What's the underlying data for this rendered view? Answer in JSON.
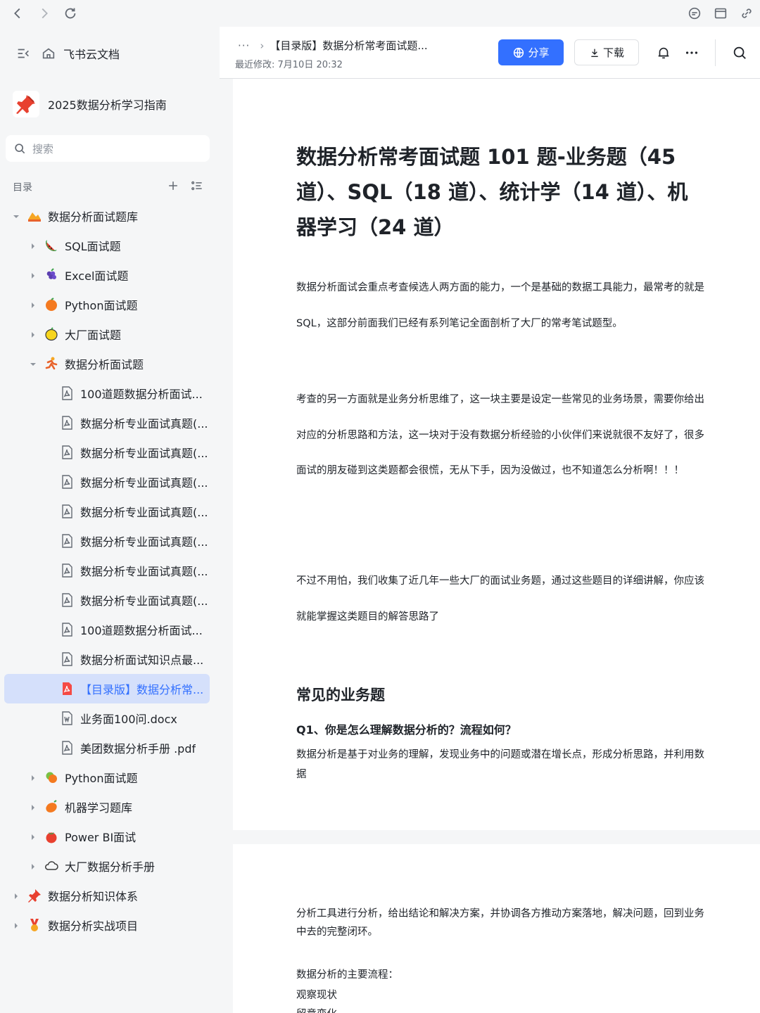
{
  "browser": {
    "back": "back-icon",
    "forward": "forward-icon",
    "reload": "reload-icon",
    "right_icons": [
      "chat-icon",
      "window-icon",
      "link-icon"
    ]
  },
  "sidebar": {
    "home_label": "飞书云文档",
    "book_title": "2025数据分析学习指南",
    "search_placeholder": "搜索",
    "toc_label": "目录",
    "tree": [
      {
        "label": "数据分析面试题库",
        "level": 0,
        "arrow": "down",
        "icon": "hand-icon"
      },
      {
        "label": "SQL面试题",
        "level": 1,
        "arrow": "right",
        "icon": "watermelon-icon"
      },
      {
        "label": "Excel面试题",
        "level": 1,
        "arrow": "right",
        "icon": "grape-icon"
      },
      {
        "label": "Python面试题",
        "level": 1,
        "arrow": "right",
        "icon": "orange-icon"
      },
      {
        "label": "大厂面试题",
        "level": 1,
        "arrow": "right",
        "icon": "lemon-icon"
      },
      {
        "label": "数据分析面试题",
        "level": 1,
        "arrow": "down",
        "icon": "running-icon"
      },
      {
        "label": "100道题数据分析面试...",
        "level": 2,
        "icon": "pdf-icon"
      },
      {
        "label": "数据分析专业面试真题(...",
        "level": 2,
        "icon": "pdf-icon"
      },
      {
        "label": "数据分析专业面试真题(...",
        "level": 2,
        "icon": "pdf-icon"
      },
      {
        "label": "数据分析专业面试真题(...",
        "level": 2,
        "icon": "pdf-icon"
      },
      {
        "label": "数据分析专业面试真题(...",
        "level": 2,
        "icon": "pdf-icon"
      },
      {
        "label": "数据分析专业面试真题(...",
        "level": 2,
        "icon": "pdf-icon"
      },
      {
        "label": "数据分析专业面试真题(...",
        "level": 2,
        "icon": "pdf-icon"
      },
      {
        "label": "数据分析专业面试真题(...",
        "level": 2,
        "icon": "pdf-icon"
      },
      {
        "label": "100道题数据分析面试...",
        "level": 2,
        "icon": "pdf-icon"
      },
      {
        "label": "数据分析面试知识点最...",
        "level": 2,
        "icon": "pdf-icon"
      },
      {
        "label": "【目录版】数据分析常...",
        "level": 2,
        "icon": "pdf-red-icon",
        "active": true
      },
      {
        "label": "业务面100问.docx",
        "level": 2,
        "icon": "word-icon"
      },
      {
        "label": "美团数据分析手册 .pdf",
        "level": 2,
        "icon": "pdf-icon"
      },
      {
        "label": "Python面试题",
        "level": 1,
        "arrow": "right",
        "icon": "fruit-icon"
      },
      {
        "label": "机器学习题库",
        "level": 1,
        "arrow": "right",
        "icon": "mango-icon"
      },
      {
        "label": "Power BI面试",
        "level": 1,
        "arrow": "right",
        "icon": "tomato-icon"
      },
      {
        "label": "大厂数据分析手册",
        "level": 1,
        "arrow": "right",
        "icon": "cloud-icon"
      },
      {
        "label": "数据分析知识体系",
        "level": 0,
        "arrow": "right",
        "icon": "pushpin-icon"
      },
      {
        "label": "数据分析实战项目",
        "level": 0,
        "arrow": "right",
        "icon": "medal-icon"
      }
    ]
  },
  "header": {
    "more": "···",
    "breadcrumb": "【目录版】数据分析常考面试题...",
    "modified": "最近修改: 7月10日 20:32",
    "share_label": "分享",
    "download_label": "下载"
  },
  "doc": {
    "title": "数据分析常考面试题 101 题-业务题（45 道）、SQL（18 道）、统计学（14 道）、机器学习（24 道）",
    "p1": "数据分析面试会重点考查候选人两方面的能力，一个是基础的数据工具能力，最常考的就是 SQL，这部分前面我们已经有系列笔记全面剖析了大厂的常考笔试题型。",
    "p2": "考查的另一方面就是业务分析思维了，这一块主要是设定一些常见的业务场景，需要你给出对应的分析思路和方法，这一块对于没有数据分析经验的小伙伴们来说就很不友好了，很多面试的朋友碰到这类题都会很慌，无从下手，因为没做过，也不知道怎么分析啊！！！",
    "p3": "不过不用怕，我们收集了近几年一些大厂的面试业务题，通过这些题目的详细讲解，你应该就能掌握这类题目的解答思路了",
    "h2": "常见的业务题",
    "h3": "Q1、你是怎么理解数据分析的？流程如何？",
    "p4": "数据分析是基于对业务的理解，发现业务中的问题或潜在增长点，形成分析思路，并利用数据",
    "p5": "分析工具进行分析，给出结论和解决方案，并协调各方推动方案落地，解决问题，回到业务中去的完整闭环。",
    "p6": "数据分析的主要流程：",
    "p7": "观察现状",
    "p8": "留意变化"
  },
  "colors": {
    "accent": "#3370ff",
    "active_bg": "#d5e0fb"
  }
}
